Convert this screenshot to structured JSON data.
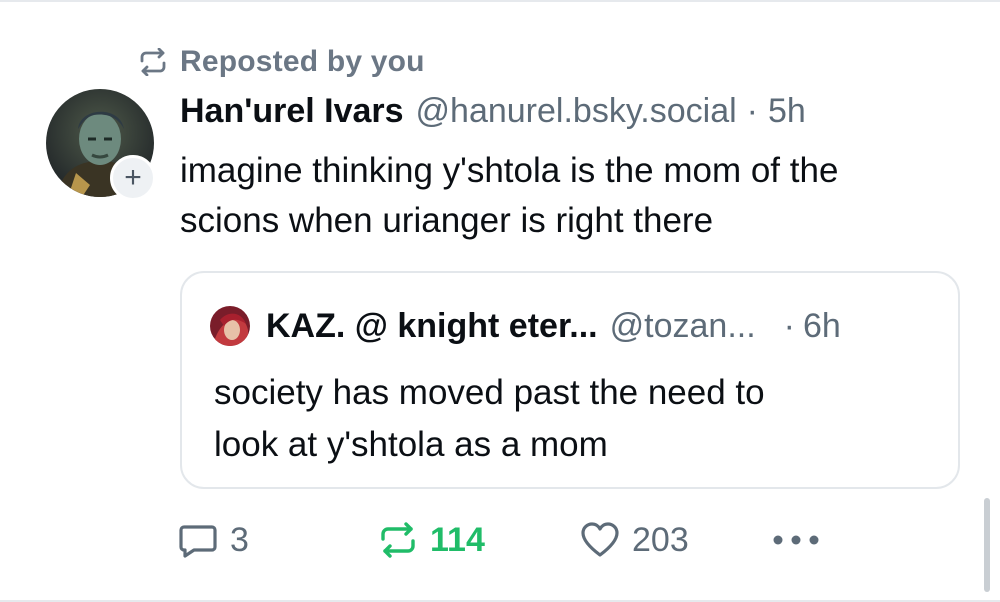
{
  "repost_banner": {
    "label": "Reposted by you",
    "icon": "repost-icon"
  },
  "post": {
    "display_name": "Han'urel Ivars",
    "handle": "@hanurel.bsky.social",
    "separator": "·",
    "time": "5h",
    "follow_icon": "+",
    "text_lines": [
      "imagine thinking y'shtola is the mom of the",
      "scions when urianger is right there"
    ]
  },
  "quoted_post": {
    "display_name": "KAZ. @ knight eter...",
    "handle": "@tozan...",
    "separator": "·",
    "time": "6h",
    "text_lines": [
      "society has moved past the need to",
      "look at y'shtola as a mom"
    ]
  },
  "actions": {
    "reply_count": "3",
    "repost_count": "114",
    "like_count": "203",
    "more_icon": "more-options-icon"
  },
  "colors": {
    "repost_active": "#20bc68",
    "muted_text": "#5d6b78",
    "border": "#e3e7eb"
  }
}
